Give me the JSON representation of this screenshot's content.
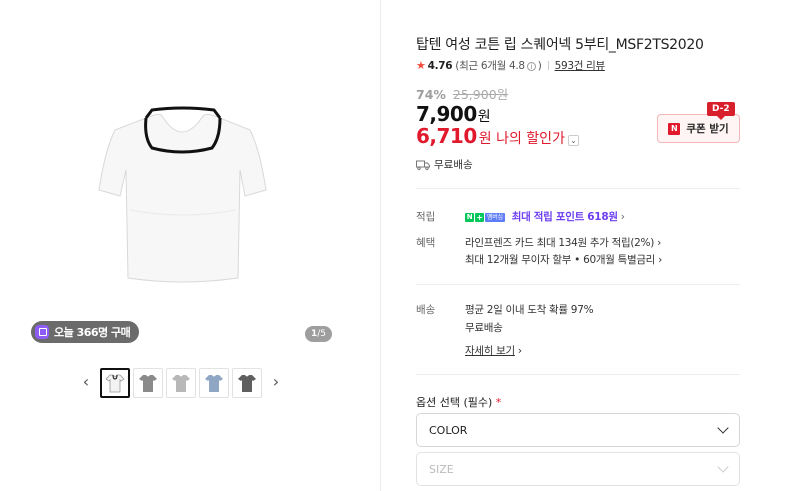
{
  "product": {
    "title": "탑텐 여성 코튼 립 스퀘어넥 5부티_MSF2TS2020",
    "rating": "4.76",
    "rating_recent_prefix": "(최근 6개월 4.8",
    "rating_recent_suffix": ")",
    "review_count": "593건 리뷰",
    "discount_pct": "74%",
    "original_price": "25,900원",
    "price": "7,900",
    "price_unit": "원",
    "my_price": "6,710",
    "my_price_label": "원 나의 할인가",
    "shipping_short": "무료배송"
  },
  "coupon": {
    "label": "쿠폰 받기",
    "dday": "D-2",
    "n_icon": "N"
  },
  "gallery": {
    "buy_count": "오늘 366명 구매",
    "page_current": "1",
    "page_total": "/5",
    "prev_arrow": "‹",
    "next_arrow": "›",
    "thumb_colors": [
      "#ffffff",
      "#8a8a8a",
      "#b8b8b8",
      "#8fa6c4",
      "#5f5f5f"
    ]
  },
  "details": {
    "points_label": "적립",
    "points_badge_n": "N",
    "points_badge_plus": "+",
    "points_badge_mem": "멤버십",
    "points_text": "최대 적립 포인트 618원",
    "benefit_label": "혜택",
    "benefit_line1": "라인프렌즈 카드 최대 134원 추가 적립(2%)",
    "benefit_line2": "최대 12개월 무이자 할부 • 60개월 특별금리",
    "delivery_label": "배송",
    "delivery_line1": "평균 2일 이내 도착 확률 97%",
    "delivery_line2": "무료배송",
    "delivery_detail": "자세히 보기"
  },
  "options": {
    "label": "옵션 선택 (필수)",
    "required_mark": "*",
    "color_select": "COLOR",
    "size_select": "SIZE"
  },
  "colors": {
    "accent_red": "#e0192d",
    "purple": "#6c3ef0",
    "green": "#03c75a"
  }
}
